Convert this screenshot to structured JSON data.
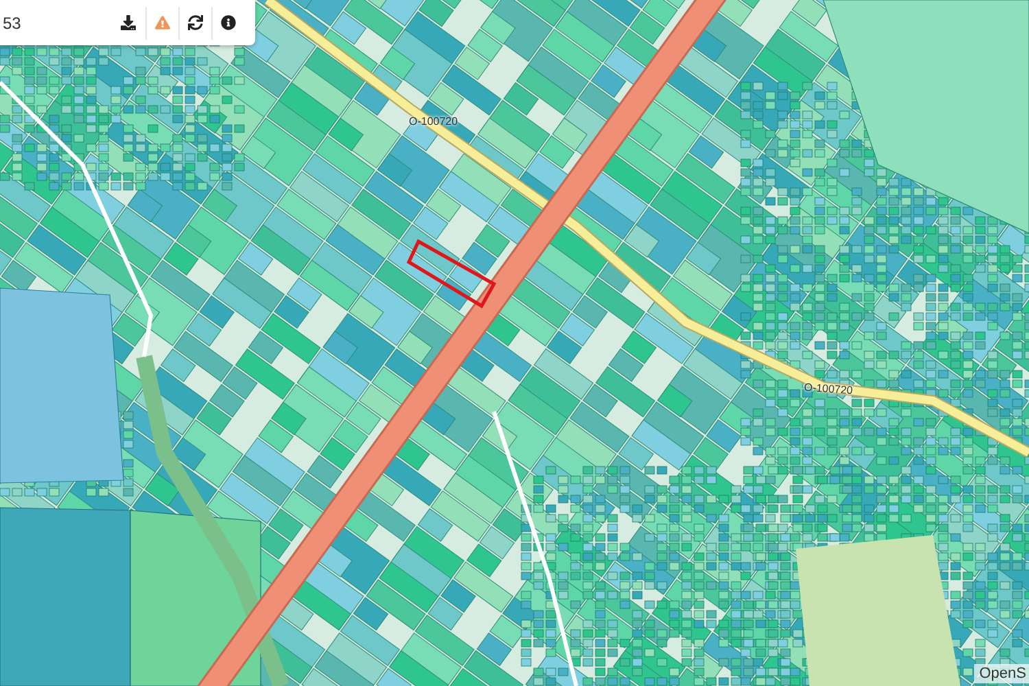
{
  "toolbar": {
    "search_value": "53",
    "buttons": [
      {
        "kind": "download"
      },
      {
        "kind": "warning"
      },
      {
        "kind": "refresh"
      },
      {
        "kind": "info"
      }
    ]
  },
  "map": {
    "road_labels": [
      "О-100720",
      "О-100720"
    ],
    "attribution": "OpenS"
  }
}
